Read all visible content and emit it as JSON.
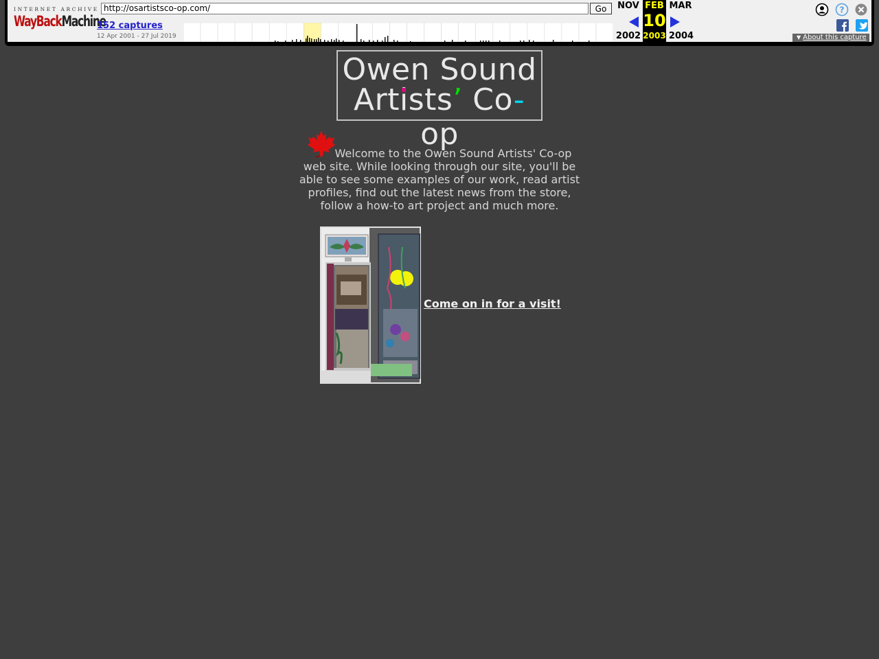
{
  "wayback": {
    "logo_top": "INTERNET ARCHIVE",
    "logo_wayback": "WayBack",
    "logo_machine": "Machine",
    "url": "http://osartistsco-op.com/",
    "go_label": "Go",
    "captures_label": "152 captures",
    "date_range": "12 Apr 2001 - 27 Jul 2019",
    "prev_month": "NOV",
    "prev_year": "2002",
    "current_month": "FEB",
    "current_day": "10",
    "current_year": "2003",
    "next_month": "MAR",
    "next_year": "2004",
    "about_label": "About this capture",
    "colors": {
      "accent": "#ffff00",
      "link": "#2222cc",
      "arrow": "#2233dd"
    }
  },
  "site": {
    "logo_line1": "Owen Sound",
    "logo_line2_a": "Art",
    "logo_line2_i": "i",
    "logo_line2_b": "sts",
    "logo_line2_apos": "’",
    "logo_line2_c": " Co",
    "logo_line2_dash": "-",
    "logo_line2_d": "op",
    "welcome_text": "Welcome to the Owen Sound Artists' Co-op web site. While looking through our site, you'll be able to see some examples of our work, read artist profiles, find out the latest news from the store, follow a how-to art project and much more.",
    "visit_link": "Come on in for a visit!",
    "colors": {
      "background": "#3e3e3e",
      "text": "#d6d6d6",
      "logo_apostrophe": "#00dd00",
      "logo_dash": "#00d7f0",
      "logo_dot": "#d0107a"
    }
  }
}
